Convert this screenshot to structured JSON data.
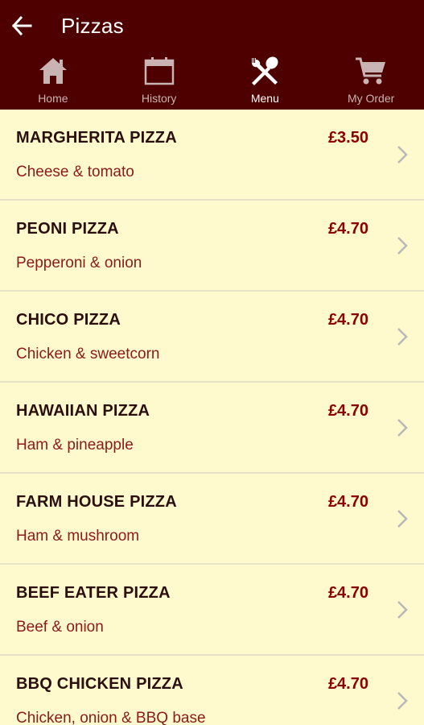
{
  "header": {
    "title": "Pizzas",
    "background": "#4e0000"
  },
  "tabs": [
    {
      "label": "Home",
      "icon": "home-icon",
      "active": false
    },
    {
      "label": "History",
      "icon": "calendar-icon",
      "active": false
    },
    {
      "label": "Menu",
      "icon": "fork-spoon-icon",
      "active": true
    },
    {
      "label": "My Order",
      "icon": "cart-icon",
      "active": false
    }
  ],
  "items": [
    {
      "name": "MARGHERITA PIZZA",
      "price": "£3.50",
      "desc": "Cheese & tomato"
    },
    {
      "name": "PEONI PIZZA",
      "price": "£4.70",
      "desc": "Pepperoni & onion"
    },
    {
      "name": "CHICO PIZZA",
      "price": "£4.70",
      "desc": "Chicken & sweetcorn"
    },
    {
      "name": "HAWAIIAN PIZZA",
      "price": "£4.70",
      "desc": "Ham & pineapple"
    },
    {
      "name": "FARM HOUSE PIZZA",
      "price": "£4.70",
      "desc": "Ham & mushroom"
    },
    {
      "name": "BEEF EATER PIZZA",
      "price": "£4.70",
      "desc": "Beef & onion"
    },
    {
      "name": "BBQ CHICKEN PIZZA",
      "price": "£4.70",
      "desc": "Chicken, onion & BBQ base"
    }
  ],
  "colors": {
    "list_background": "#fffacd",
    "item_name": "#2b0f0f",
    "price": "#8b0000",
    "description": "#8b1a1a",
    "chevron": "#b8b8b8"
  }
}
